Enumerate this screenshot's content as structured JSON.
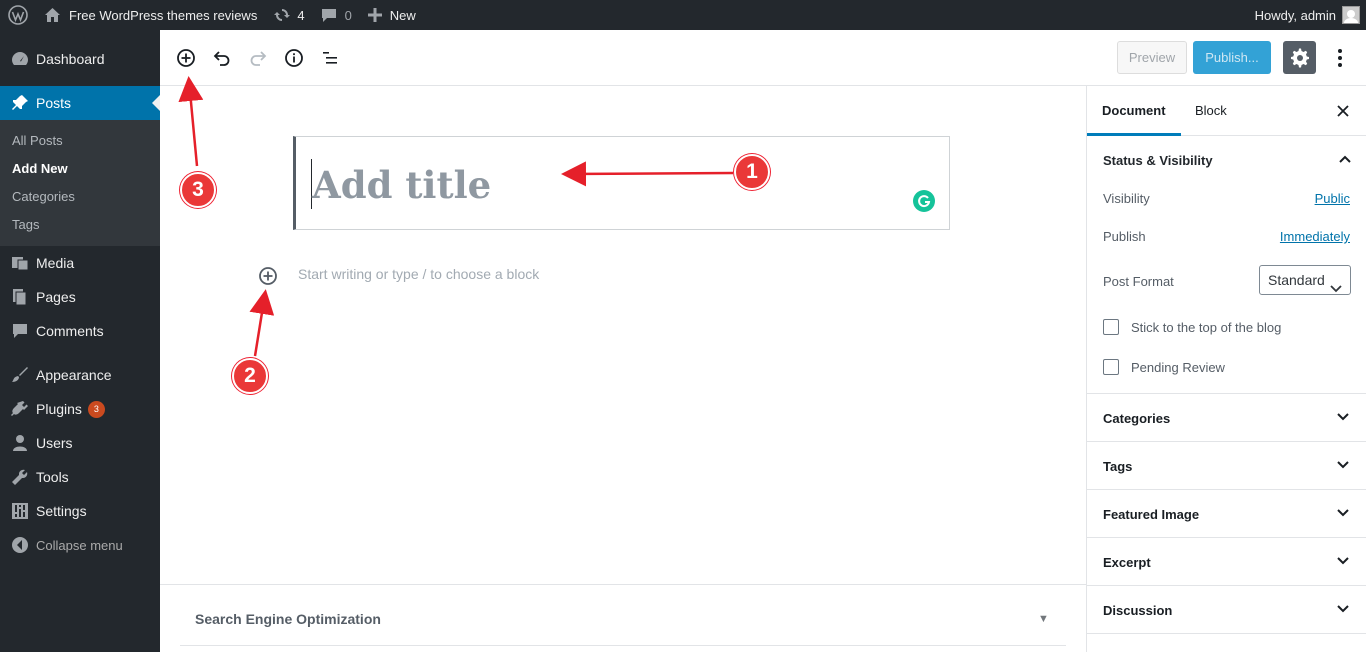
{
  "adminbar": {
    "site_name": "Free WordPress themes reviews",
    "updates_count": "4",
    "comments_count": "0",
    "new_label": "New",
    "howdy": "Howdy, admin"
  },
  "sidebar": {
    "dashboard": "Dashboard",
    "posts": "Posts",
    "posts_sub": [
      "All Posts",
      "Add New",
      "Categories",
      "Tags"
    ],
    "media": "Media",
    "pages": "Pages",
    "comments": "Comments",
    "appearance": "Appearance",
    "plugins": "Plugins",
    "plugins_badge": "3",
    "users": "Users",
    "tools": "Tools",
    "settings": "Settings",
    "collapse": "Collapse menu"
  },
  "header": {
    "preview_label": "Preview",
    "publish_label": "Publish..."
  },
  "editor": {
    "title_placeholder": "Add title",
    "block_placeholder": "Start writing or type / to choose a block"
  },
  "seo": {
    "title": "Search Engine Optimization",
    "toggle": "▼"
  },
  "settings_sidebar": {
    "tabs": [
      "Document",
      "Block"
    ],
    "status_visibility": "Status & Visibility",
    "visibility_label": "Visibility",
    "visibility_value": "Public",
    "publish_label": "Publish",
    "publish_value": "Immediately",
    "post_format_label": "Post Format",
    "post_format_value": "Standard",
    "sticky_label": "Stick to the top of the blog",
    "pending_label": "Pending Review",
    "panels": [
      "Categories",
      "Tags",
      "Featured Image",
      "Excerpt",
      "Discussion"
    ]
  },
  "annotations": {
    "num1": "1",
    "num2": "2",
    "num3": "3"
  },
  "colors": {
    "admin_dark": "#23282d",
    "accent_blue": "#0073aa",
    "annotation_red": "#ea3838"
  }
}
